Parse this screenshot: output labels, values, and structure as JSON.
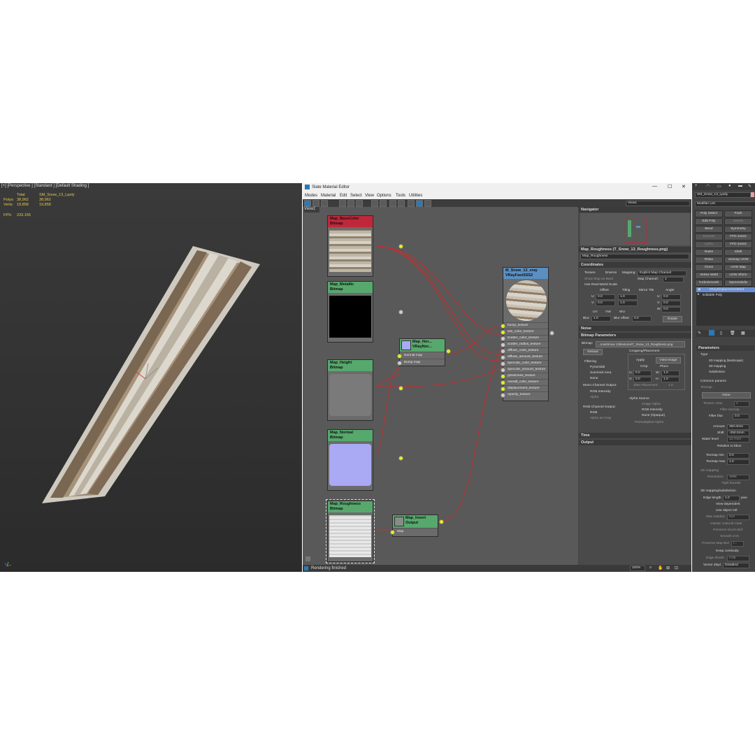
{
  "viewport": {
    "label": "[+] [Perspective ] [Standard ] [Default Shading ]",
    "stats": {
      "col_total": "Total",
      "col_object": "SM_Snow_13_Lpoly",
      "polys_label": "Polys:",
      "polys_total": "38,962",
      "polys_obj": "38,962",
      "verts_label": "Verts:",
      "verts_total": "19,858",
      "verts_obj": "19,858",
      "fps_label": "FPS:",
      "fps_value": "233.155"
    }
  },
  "sme": {
    "title": "Slate Material Editor",
    "menu": [
      "Modes",
      "Material",
      "Edit",
      "Select",
      "View",
      "Options",
      "Tools",
      "Utilities"
    ],
    "view_tab": "View1",
    "view_dropdown": "View1",
    "nodes": {
      "basecolor": {
        "name": "Map_BaseColor",
        "type": "Bitmap"
      },
      "metallic": {
        "name": "Map_Metallic",
        "type": "Bitmap"
      },
      "height": {
        "name": "Map_Height",
        "type": "Bitmap"
      },
      "normal": {
        "name": "Map_Normal",
        "type": "Bitmap"
      },
      "roughness": {
        "name": "Map_Roughness",
        "type": "Bitmap"
      },
      "normalmap": {
        "name": "Map_Nor...",
        "type": "VRayNor...",
        "slots": [
          "Normal map",
          "Bump map"
        ]
      },
      "invert": {
        "name": "Map_Invert",
        "type": "Output",
        "slots": [
          "Map"
        ]
      },
      "material": {
        "name": "M_Snow_13_vray",
        "type": "VRayFastSSS2",
        "slots": [
          "bump_texture",
          "sss_color_texture",
          "scatter_color_texture",
          "scatter_radius_texture",
          "diffuse_color_texture",
          "diffuse_amount_texture",
          "specular_color_texture",
          "specular_amount_texture",
          "glossiness_texture",
          "overall_color_texture",
          "displacement_texture",
          "opacity_texture"
        ]
      }
    },
    "navigator": "Navigator",
    "params": {
      "title": "Map_Roughness (T_Snow_13_Roughness.png)",
      "name_field": "Map_Roughness",
      "coordinates": "Coordinates",
      "texture": "Texture",
      "environ": "Environ",
      "mapping_label": "Mapping:",
      "mapping_value": "Explicit Map Channel",
      "show_map_on_back": "Show Map on Back",
      "map_channel_label": "Map Channel:",
      "map_channel_value": "1",
      "use_real_world": "Use Real-World Scale",
      "offset": "Offset",
      "tiling": "Tiling",
      "mirror_tile": "Mirror Tile",
      "angle": "Angle",
      "u_label": "U:",
      "v_label": "V:",
      "w_label": "W:",
      "u_offset": "0.0",
      "v_offset": "0.0",
      "u_tiling": "1.0",
      "v_tiling": "1.0",
      "u_angle": "0.0",
      "v_angle": "0.0",
      "w_angle": "0.0",
      "uv": "UV",
      "vw": "VW",
      "wu": "WU",
      "blur_label": "Blur:",
      "blur_value": "1.0",
      "blur_offset_label": "Blur offset:",
      "blur_offset_value": "0.0",
      "rotate": "Rotate",
      "noise": "Noise",
      "bitmap_params": "Bitmap Parameters",
      "bitmap_label": "Bitmap:",
      "bitmap_path": "...now\\Snow 13\\textures\\T_Snow_13_Roughness.png",
      "reload": "Reload",
      "cropping": "Cropping/Placement",
      "apply": "Apply",
      "view_image": "View Image",
      "crop": "Crop",
      "place": "Place",
      "crop_u": "0.0",
      "crop_v": "0.0",
      "crop_w": "1.0",
      "crop_h": "1.0",
      "w_short": "W:",
      "h_short": "H:",
      "jitter": "Jitter Placement:",
      "jitter_value": "1.0",
      "filtering": "Filtering",
      "pyramidal": "Pyramidal",
      "summed": "Summed Area",
      "none": "None",
      "mono_out": "Mono Channel Output:",
      "rgb_intensity": "RGB Intensity",
      "alpha": "Alpha",
      "rgb_out": "RGB Channel Output:",
      "rgb": "RGB",
      "alpha_as_gray": "Alpha as Gray",
      "alpha_source": "Alpha Source",
      "image_alpha": "Image Alpha",
      "rgb_intensity2": "RGB Intensity",
      "none_opaque": "None (Opaque)",
      "premult": "Premultiplied Alpha",
      "time": "Time",
      "output": "Output"
    },
    "status": "Rendering finished",
    "zoom": "100%"
  },
  "cmd": {
    "object_name": "SM_Snow_13_Lpoly",
    "modifier_list": "Modifier List",
    "modifiers": [
      [
        "Poly Select",
        "Push"
      ],
      [
        "Edit Poly",
        "Sweep"
      ],
      [
        "Bend",
        "Symmetry"
      ],
      [
        "Extrude",
        "FFD 2x2x2"
      ],
      [
        "Lathe",
        "FFD 3x3x3"
      ],
      [
        "Noise",
        "Shell"
      ],
      [
        "Relax",
        "Unwrap UVW"
      ],
      [
        "Clone",
        "UVW Map"
      ],
      [
        "Vertex Weld",
        "UVW Xform"
      ],
      [
        "TurboSmooth",
        "OpenSubdiv"
      ]
    ],
    "stack": [
      "VRayDisplacementMod",
      "Editable Poly"
    ],
    "parameters": "Parameters",
    "type_label": "Type",
    "type_opts": [
      "2D mapping (landscape)",
      "3D mapping",
      "Subdivision"
    ],
    "common": "Common params",
    "texmap": "Texmap",
    "texmap_value": "None",
    "texture_chan": "Texture chan",
    "texture_chan_value": "1",
    "filter_texmap": "Filter texmap",
    "filter_blur": "Filter blur",
    "filter_blur_value": "0.0",
    "amount": "Amount",
    "amount_value": "300.0mm",
    "shift": "Shift",
    "shift_value": "-250.0mm",
    "water_level": "Water level",
    "water_level_value": "12.7mm",
    "relative_bbox": "Relative to bbox",
    "texmap_min": "Texmap min",
    "texmap_min_value": "0.0",
    "texmap_max": "Texmap max",
    "texmap_max_value": "1.0",
    "mapping_2d": "2D mapping",
    "resolution": "Resolution",
    "resolution_value": "4096",
    "tight_bounds": "Tight bounds",
    "mapping_3d": "3D mapping/subdivision",
    "edge_length": "Edge length",
    "edge_length_value": "1.0",
    "pixels": "pixe",
    "view_dependent": "View-dependent",
    "use_object_mtl": "Use object mtl",
    "max_subdivs": "Max subdivs",
    "max_subdivs_value": "512",
    "classic_catmull": "Classic Catmull Clark",
    "preserve_geom": "Preserve Geom Brd",
    "smooth_uvs": "Smooth UVs",
    "preserve_map": "Preserve Map Brd",
    "preserve_map_value": "I...",
    "keep_continuity": "Keep continuity",
    "edge_thresh": "Edge thresh",
    "edge_thresh_value": "0.05",
    "vector_displ": "Vector displ",
    "vector_displ_value": "Disabled"
  },
  "colors": {
    "node_header": "#57a86d",
    "material_header": "#5b8fc2",
    "wire": "#d12a2a",
    "socket_active": "#e6f020",
    "stat_text": "#e8c84a"
  }
}
